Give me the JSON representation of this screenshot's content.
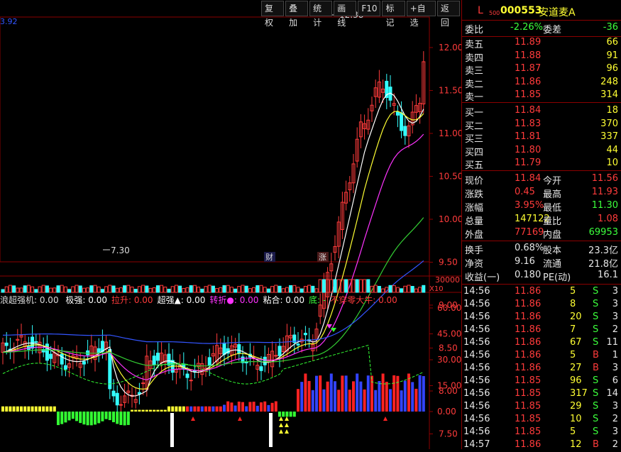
{
  "toolbar": [
    "复权",
    "叠加",
    "统计",
    "画线",
    "F10",
    "标记",
    "+自选",
    "返回"
  ],
  "top_left_value": "3.92",
  "stock": {
    "prefix": "L",
    "sub": "500",
    "code": "000553",
    "name": "安道麦A"
  },
  "main_chart": {
    "y_ticks": [
      "12.00",
      "11.50",
      "11.00",
      "10.50",
      "10.00",
      "9.50",
      "9.00",
      "8.50",
      "8.00",
      "7.50"
    ],
    "high_label": "12.38",
    "low_label": "7.30",
    "event_labels": [
      "财",
      "涨"
    ],
    "colors": {
      "up": "#ff3b3b",
      "down": "#33ffff",
      "ma5": "#ffffff",
      "ma10": "#ffff33",
      "ma20": "#ff33ff",
      "ma60": "#33cc33",
      "ma120": "#3355ff"
    }
  },
  "volume": {
    "tick": "30000",
    "unit": "X10"
  },
  "indicator": {
    "name": "浪超强机: 0.00",
    "items": [
      {
        "label": "极强: 0.00",
        "color": "#ffffff"
      },
      {
        "label": "拉升: 0.00",
        "color": "#ff3b3b"
      },
      {
        "label": "超强▲: 0.00",
        "color": "#ffffff"
      },
      {
        "label": "转折●: 0.00",
        "color": "#ff33ff"
      },
      {
        "label": "粘合: 0.00",
        "color": "#ffffff"
      },
      {
        "label": "底: -",
        "color": "#3cff3c"
      },
      {
        "label": "不穿零大牛: 0.00",
        "color": "#ff3b3b"
      }
    ],
    "y_ticks": [
      "60.00",
      "45.00",
      "30.00",
      "15.00",
      "0.00"
    ]
  },
  "orderbook": {
    "weibi": {
      "label": "委比",
      "value": "-2.26%",
      "label2": "委差",
      "value2": "-36"
    },
    "sells": [
      {
        "label": "卖五",
        "price": "11.89",
        "vol": "66"
      },
      {
        "label": "卖四",
        "price": "11.88",
        "vol": "91"
      },
      {
        "label": "卖三",
        "price": "11.87",
        "vol": "96"
      },
      {
        "label": "卖二",
        "price": "11.86",
        "vol": "248"
      },
      {
        "label": "卖一",
        "price": "11.85",
        "vol": "314"
      }
    ],
    "buys": [
      {
        "label": "买一",
        "price": "11.84",
        "vol": "18"
      },
      {
        "label": "买二",
        "price": "11.83",
        "vol": "370"
      },
      {
        "label": "买三",
        "price": "11.81",
        "vol": "337"
      },
      {
        "label": "买四",
        "price": "11.80",
        "vol": "44"
      },
      {
        "label": "买五",
        "price": "11.79",
        "vol": "10"
      }
    ]
  },
  "stats": [
    {
      "l1": "现价",
      "v1": "11.84",
      "c1": "red",
      "l2": "今开",
      "v2": "11.56",
      "c2": "red"
    },
    {
      "l1": "涨跌",
      "v1": "0.45",
      "c1": "red",
      "l2": "最高",
      "v2": "11.93",
      "c2": "red"
    },
    {
      "l1": "涨幅",
      "v1": "3.95%",
      "c1": "red",
      "l2": "最低",
      "v2": "11.30",
      "c2": "green"
    },
    {
      "l1": "总量",
      "v1": "147122",
      "c1": "yellow",
      "l2": "量比",
      "v2": "1.08",
      "c2": "red"
    },
    {
      "l1": "外盘",
      "v1": "77169",
      "c1": "red",
      "l2": "内盘",
      "v2": "69953",
      "c2": "green"
    }
  ],
  "stats2": [
    {
      "l1": "换手",
      "v1": "0.68%",
      "l2": "股本",
      "v2": "23.3亿"
    },
    {
      "l1": "净资",
      "v1": "9.16",
      "l2": "流通",
      "v2": "21.8亿"
    },
    {
      "l1": "收益(一)",
      "v1": "0.180",
      "l2": "PE(动)",
      "v2": "16.1"
    }
  ],
  "ticks": [
    {
      "time": "14:56",
      "price": "11.86",
      "vol": "5",
      "side": "S",
      "n": "3"
    },
    {
      "time": "14:56",
      "price": "11.86",
      "vol": "8",
      "side": "S",
      "n": "3"
    },
    {
      "time": "14:56",
      "price": "11.86",
      "vol": "20",
      "side": "S",
      "n": "3"
    },
    {
      "time": "14:56",
      "price": "11.86",
      "vol": "7",
      "side": "S",
      "n": "2"
    },
    {
      "time": "14:56",
      "price": "11.86",
      "vol": "67",
      "side": "S",
      "n": "11"
    },
    {
      "time": "14:56",
      "price": "11.86",
      "vol": "5",
      "side": "B",
      "n": "1"
    },
    {
      "time": "14:56",
      "price": "11.86",
      "vol": "27",
      "side": "B",
      "n": "3"
    },
    {
      "time": "14:56",
      "price": "11.85",
      "vol": "96",
      "side": "S",
      "n": "6"
    },
    {
      "time": "14:56",
      "price": "11.85",
      "vol": "317",
      "side": "S",
      "n": "14"
    },
    {
      "time": "14:56",
      "price": "11.85",
      "vol": "29",
      "side": "S",
      "n": "3"
    },
    {
      "time": "14:56",
      "price": "11.85",
      "vol": "10",
      "side": "S",
      "n": "2"
    },
    {
      "time": "14:56",
      "price": "11.85",
      "vol": "5",
      "side": "S",
      "n": "3"
    },
    {
      "time": "14:57",
      "price": "11.86",
      "vol": "12",
      "side": "B",
      "n": "2"
    }
  ]
}
